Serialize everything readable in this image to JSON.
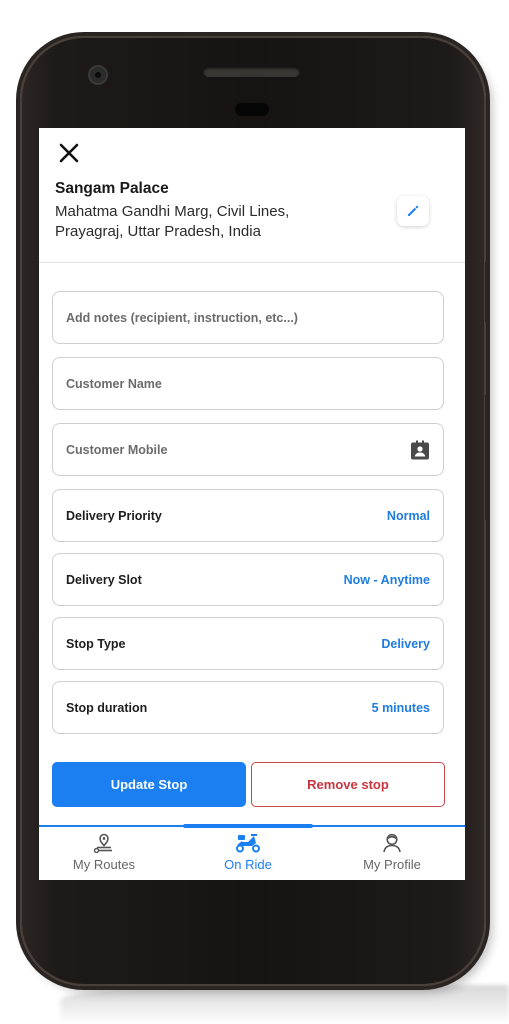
{
  "place": {
    "name": "Sangam Palace",
    "address": "Mahatma Gandhi Marg, Civil Lines, Prayagraj, Uttar Pradesh, India"
  },
  "form": {
    "notes_placeholder": "Add notes (recipient, instruction, etc...)",
    "customer_name_placeholder": "Customer Name",
    "customer_mobile_placeholder": "Customer Mobile",
    "delivery_priority": {
      "label": "Delivery Priority",
      "value": "Normal"
    },
    "delivery_slot": {
      "label": "Delivery Slot",
      "value": "Now - Anytime"
    },
    "stop_type": {
      "label": "Stop Type",
      "value": "Delivery"
    },
    "stop_duration": {
      "label": "Stop duration",
      "value": "5 minutes"
    }
  },
  "actions": {
    "update_label": "Update Stop",
    "remove_label": "Remove stop"
  },
  "tabs": [
    {
      "label": "My Routes",
      "icon": "route-pin-icon",
      "active": false
    },
    {
      "label": "On Ride",
      "icon": "scooter-icon",
      "active": true
    },
    {
      "label": "My Profile",
      "icon": "profile-icon",
      "active": false
    }
  ],
  "colors": {
    "accent": "#1b7ff2",
    "danger": "#c9353f",
    "value_text": "#1f7de0"
  }
}
